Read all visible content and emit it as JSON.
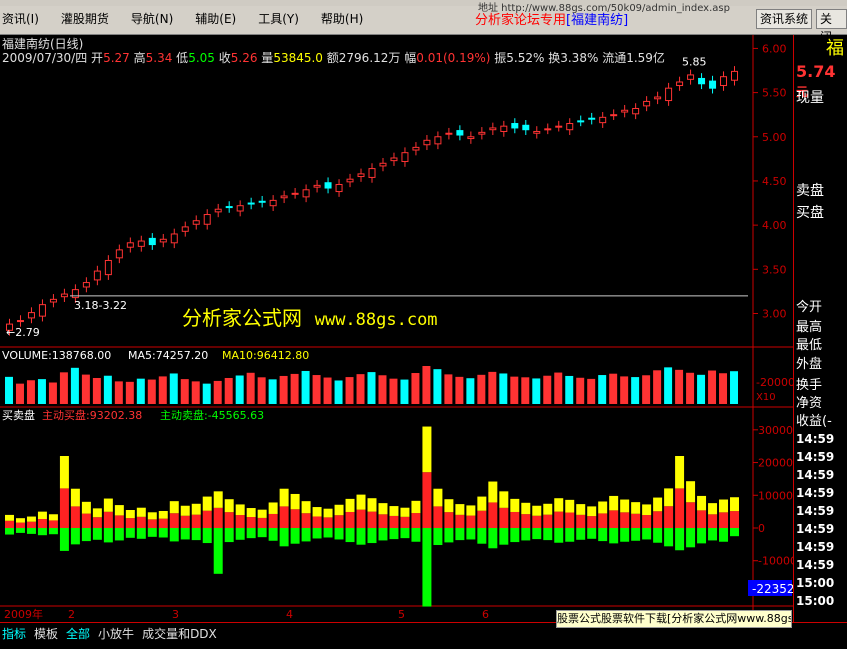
{
  "menu": [
    "资讯(I)",
    "灌股期货",
    "导航(N)",
    "辅助(E)",
    "工具(Y)",
    "帮助(H)"
  ],
  "address_fragment": "地址  http://www.88gs.com/50k09/admin_index.asp",
  "slogan": {
    "prefix": "分析家论坛专用",
    "name": "[福建南纺]"
  },
  "buttons": {
    "news": "资讯系统",
    "close": "关闭"
  },
  "stock": {
    "title": "福建南纺(日线)",
    "date": "2009/07/30/四",
    "open_label": "开",
    "open": "5.27",
    "high_label": "高",
    "high": "5.34",
    "low_label": "低",
    "low": "5.05",
    "close_label": "收",
    "close": "5.26",
    "vol_label": "量",
    "vol": "53845.0",
    "amount_label": "额",
    "amount": "2796.12万",
    "change_label": "幅",
    "change": "0.01(0.19%)",
    "amplitude": "振5.52%",
    "turnover": "换3.38%",
    "float": "流通1.59亿"
  },
  "annotations": {
    "high_marker": "5.85",
    "range_label": "3.18-3.22",
    "low_marker": "←2.79"
  },
  "watermark": {
    "text": "分析家公式网",
    "url": "www.88gs.com"
  },
  "volume_panel": {
    "vol": "VOLUME:138768.00",
    "ma5": "MA5:74257.20",
    "ma10": "MA10:96412.80",
    "tick": "-20000",
    "scale": "X10"
  },
  "trade_panel": {
    "title": "买卖盘",
    "buy": "主动买盘:93202.38",
    "sell": "主动卖盘:-45565.63",
    "neg_value": "-22352"
  },
  "price_axis": [
    "6.00",
    "5.50",
    "5.00",
    "4.50",
    "4.00",
    "3.50",
    "3.00"
  ],
  "trade_axis": [
    "30000",
    "20000",
    "10000",
    "0",
    "-10000"
  ],
  "time_axis": [
    "2009年",
    "2",
    "3",
    "4",
    "5",
    "6"
  ],
  "right_panel": {
    "char": "福",
    "price": "5.74",
    "price_suffix": "元",
    "labels": [
      "现量",
      "卖盘",
      "买盘",
      "今开",
      "最高",
      "最低",
      "外盘",
      "换手",
      "净资",
      "收益(-"
    ],
    "times": [
      "14:59",
      "14:59",
      "14:59",
      "14:59",
      "14:59",
      "14:59",
      "14:59",
      "14:59",
      "15:00",
      "15:00"
    ]
  },
  "tabs": [
    "指标",
    "模板",
    "全部",
    "小放牛",
    "成交量和DDX"
  ],
  "banner": "股票公式股票软件下载[分析家公式网www.88gs.com]",
  "colors": {
    "up": "#ff3333",
    "down": "#00ffff",
    "buy": "#ffff00",
    "sell": "#00ff00",
    "grid": "#cc0000"
  },
  "chart_data": [
    {
      "type": "candlestick",
      "title": "福建南纺(日线)",
      "ylim": [
        2.7,
        6.05
      ],
      "values": [
        2.88,
        2.92,
        3.01,
        3.1,
        3.16,
        3.22,
        3.27,
        3.35,
        3.48,
        3.6,
        3.72,
        3.8,
        3.82,
        3.78,
        3.84,
        3.9,
        3.98,
        4.05,
        4.12,
        4.18,
        4.2,
        4.22,
        4.24,
        4.26,
        4.28,
        4.33,
        4.36,
        4.4,
        4.45,
        4.42,
        4.46,
        4.52,
        4.58,
        4.64,
        4.7,
        4.76,
        4.82,
        4.88,
        4.96,
        5.0,
        5.04,
        5.02,
        5.0,
        5.05,
        5.1,
        5.12,
        5.1,
        5.08,
        5.06,
        5.09,
        5.12,
        5.15,
        5.18,
        5.2,
        5.22,
        5.25,
        5.3,
        5.32,
        5.4,
        5.45,
        5.55,
        5.62,
        5.7,
        5.6,
        5.55,
        5.68,
        5.74
      ]
    },
    {
      "type": "bar",
      "title": "VOLUME",
      "values": [
        12000,
        9000,
        10500,
        11000,
        9500,
        14000,
        16000,
        13000,
        11500,
        12500,
        10000,
        9800,
        11200,
        10800,
        12200,
        13500,
        11000,
        10000,
        9000,
        10200,
        11500,
        12600,
        13800,
        11800,
        10900,
        12400,
        13300,
        14600,
        12800,
        11700,
        10400,
        11900,
        13200,
        14100,
        12700,
        11200,
        10800,
        13700,
        16800,
        15400,
        13100,
        12000,
        11400,
        12900,
        14200,
        13500,
        12100,
        11800,
        11300,
        12500,
        13900,
        12400,
        11600,
        11100,
        12800,
        13400,
        12200,
        11900,
        12700,
        14900,
        16200,
        15100,
        13800,
        12900,
        14800,
        13600,
        14500
      ]
    },
    {
      "type": "bar",
      "title": "买卖盘",
      "series": [
        {
          "name": "主动买盘",
          "values": [
            4000,
            3000,
            3500,
            5000,
            4200,
            22000,
            12000,
            8000,
            6000,
            9000,
            7000,
            5500,
            6200,
            4800,
            5200,
            8200,
            6800,
            7400,
            9600,
            11200,
            8800,
            7200,
            6100,
            5600,
            7800,
            12000,
            10400,
            8200,
            6400,
            5900,
            7100,
            8900,
            10200,
            9100,
            7600,
            6700,
            6200,
            8300,
            31000,
            12000,
            8800,
            7300,
            6900,
            9600,
            14200,
            11200,
            8900,
            7700,
            6800,
            7400,
            9100,
            8600,
            7300,
            6600,
            8100,
            9800,
            8700,
            7900,
            7200,
            9300,
            12100,
            22000,
            14300,
            9800,
            7600,
            8700,
            9400
          ]
        },
        {
          "name": "主动卖盘",
          "values": [
            -2000,
            -1500,
            -1800,
            -2200,
            -1900,
            -7000,
            -5000,
            -4000,
            -3600,
            -4400,
            -3800,
            -3000,
            -3300,
            -2700,
            -2900,
            -4100,
            -3500,
            -3700,
            -4600,
            -14000,
            -4300,
            -3600,
            -3100,
            -2800,
            -3900,
            -5600,
            -4800,
            -4100,
            -3200,
            -2900,
            -3500,
            -4300,
            -5100,
            -4600,
            -3800,
            -3400,
            -3100,
            -4200,
            -24000,
            -5200,
            -4400,
            -3700,
            -3500,
            -4800,
            -6200,
            -5100,
            -4300,
            -3800,
            -3400,
            -3700,
            -4500,
            -4200,
            -3600,
            -3300,
            -4000,
            -4700,
            -4200,
            -3900,
            -3500,
            -4500,
            -5600,
            -6800,
            -5900,
            -4700,
            -3800,
            -4200,
            -2500
          ]
        }
      ]
    }
  ]
}
